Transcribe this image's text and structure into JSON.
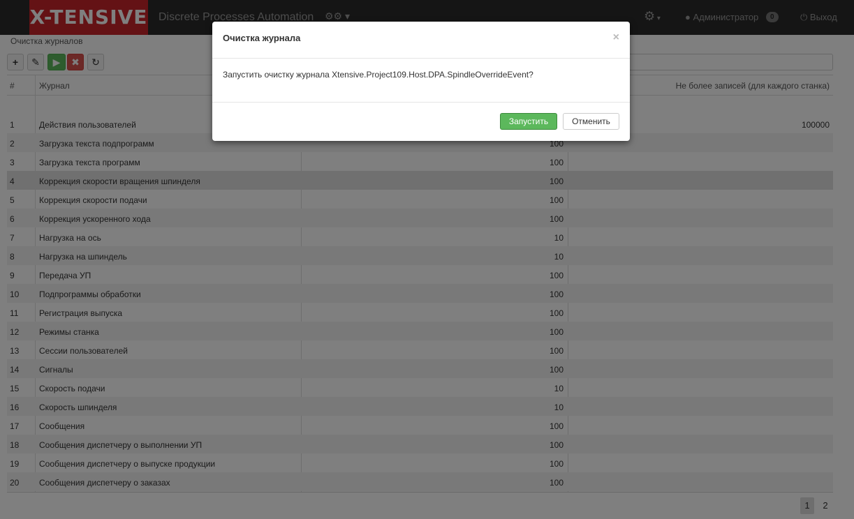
{
  "app": {
    "logo": "X-TENSIVE",
    "title": "Discrete Processes Automation"
  },
  "header": {
    "user": "Администратор",
    "notifications": "0",
    "logout": "Выход",
    "icons": [
      "cubes-icon",
      "gear-icon",
      "user-icon",
      "power-icon"
    ]
  },
  "page": {
    "title": "Очистка журналов"
  },
  "table": {
    "columns": {
      "num": "#",
      "name": "Журнал",
      "count": "Не более записей (для каждого станка)"
    },
    "rows": [
      {
        "num": "1",
        "name": "Действия пользователей",
        "days": "",
        "count": "100000"
      },
      {
        "num": "2",
        "name": "Загрузка текста подпрограмм",
        "days": "100",
        "count": ""
      },
      {
        "num": "3",
        "name": "Загрузка текста программ",
        "days": "100",
        "count": ""
      },
      {
        "num": "4",
        "name": "Коррекция скорости вращения шпинделя",
        "days": "100",
        "count": ""
      },
      {
        "num": "5",
        "name": "Коррекция скорости подачи",
        "days": "100",
        "count": ""
      },
      {
        "num": "6",
        "name": "Коррекция ускоренного хода",
        "days": "100",
        "count": ""
      },
      {
        "num": "7",
        "name": "Нагрузка на ось",
        "days": "10",
        "count": ""
      },
      {
        "num": "8",
        "name": "Нагрузка на шпиндель",
        "days": "10",
        "count": ""
      },
      {
        "num": "9",
        "name": "Передача УП",
        "days": "100",
        "count": ""
      },
      {
        "num": "10",
        "name": "Подпрограммы обработки",
        "days": "100",
        "count": ""
      },
      {
        "num": "11",
        "name": "Регистрация выпуска",
        "days": "100",
        "count": ""
      },
      {
        "num": "12",
        "name": "Режимы станка",
        "days": "100",
        "count": ""
      },
      {
        "num": "13",
        "name": "Сессии пользователей",
        "days": "100",
        "count": ""
      },
      {
        "num": "14",
        "name": "Сигналы",
        "days": "100",
        "count": ""
      },
      {
        "num": "15",
        "name": "Скорость подачи",
        "days": "10",
        "count": ""
      },
      {
        "num": "16",
        "name": "Скорость шпинделя",
        "days": "10",
        "count": ""
      },
      {
        "num": "17",
        "name": "Сообщения",
        "days": "100",
        "count": ""
      },
      {
        "num": "18",
        "name": "Сообщения диспетчеру о выполнении УП",
        "days": "100",
        "count": ""
      },
      {
        "num": "19",
        "name": "Сообщения диспетчеру о выпуске продукции",
        "days": "100",
        "count": ""
      },
      {
        "num": "20",
        "name": "Сообщения диспетчеру о заказах",
        "days": "100",
        "count": ""
      }
    ],
    "selected_row": 4
  },
  "pager": {
    "pages": [
      "1",
      "2"
    ],
    "current": "1"
  },
  "modal": {
    "title": "Очистка журнала",
    "close": "×",
    "message": "Запустить очистку журнала Xtensive.Project109.Host.DPA.SpindleOverrideEvent?",
    "confirm": "Запустить",
    "cancel": "Отменить"
  }
}
